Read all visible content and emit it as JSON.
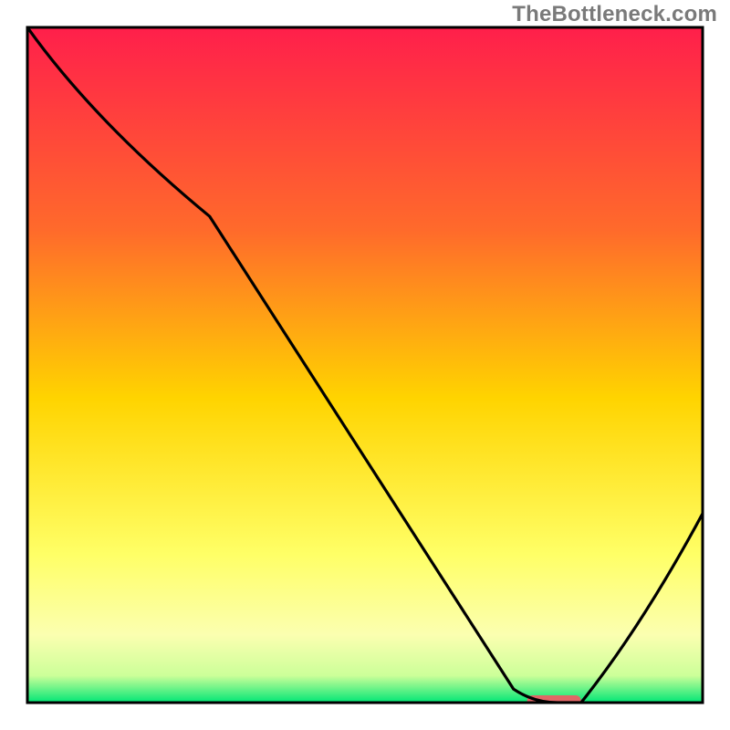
{
  "watermark": "TheBottleneck.com",
  "chart_data": {
    "type": "line",
    "title": "",
    "xlabel": "",
    "ylabel": "",
    "xlim": [
      0,
      100
    ],
    "ylim": [
      0,
      100
    ],
    "grid": false,
    "legend": false,
    "series": [
      {
        "name": "bottleneck-curve",
        "x": [
          0,
          10,
          27,
          72,
          75,
          82,
          100
        ],
        "y": [
          100,
          86,
          72,
          2,
          0,
          0,
          28
        ]
      }
    ],
    "marker": {
      "name": "optimal-range-marker",
      "x_start": 74,
      "x_end": 82,
      "y": 0,
      "color": "#e06666"
    },
    "background_gradient": {
      "top": "#ff1f4b",
      "upper_mid": "#ff9933",
      "mid": "#ffd400",
      "lower_mid": "#ffff66",
      "near_bottom": "#ccff99",
      "bottom": "#00e676"
    }
  },
  "plot": {
    "inner_x": 30,
    "inner_y": 30,
    "inner_w": 740,
    "inner_h": 740
  }
}
